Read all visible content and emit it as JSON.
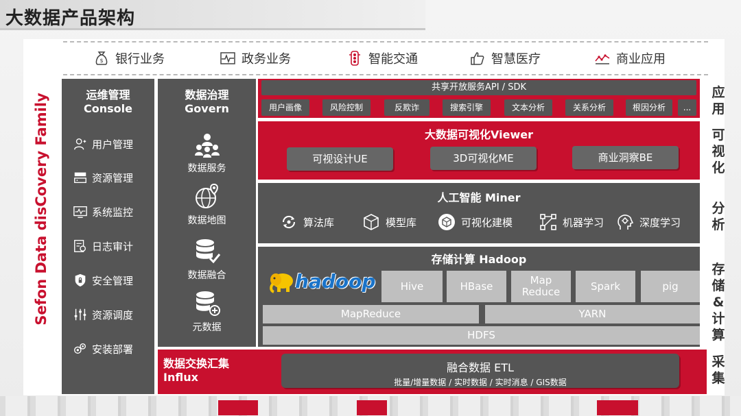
{
  "title": "大数据产品架构",
  "industries": [
    {
      "label": "银行业务",
      "icon": "bank-bag-icon"
    },
    {
      "label": "政务业务",
      "icon": "pulse-icon"
    },
    {
      "label": "智能交通",
      "icon": "traffic-light-icon"
    },
    {
      "label": "智慧医疗",
      "icon": "thumbs-up-icon"
    },
    {
      "label": "商业应用",
      "icon": "line-chart-icon"
    }
  ],
  "family_title": "Sefon Data disCovery Family",
  "ops": {
    "title_cn": "运维管理",
    "title_en": "Console",
    "items": [
      "用户管理",
      "资源管理",
      "系统监控",
      "日志审计",
      "安全管理",
      "资源调度",
      "安装部署"
    ]
  },
  "govern": {
    "title_cn": "数据治理",
    "title_en": "Govern",
    "items": [
      "数据服务",
      "数据地图",
      "数据融合",
      "元数据"
    ]
  },
  "app": {
    "api_label": "共享开放服务API / SDK",
    "chips": [
      "用户画像",
      "风险控制",
      "反欺诈",
      "搜索引擎",
      "文本分析",
      "关系分析",
      "根因分析",
      "..."
    ]
  },
  "viewer": {
    "title": "大数据可视化Viewer",
    "items": [
      "可视设计UE",
      "3D可视化ME",
      "商业洞察BE"
    ]
  },
  "miner": {
    "title": "人工智能 Miner",
    "items": [
      "算法库",
      "模型库",
      "可视化建模",
      "机器学习",
      "深度学习"
    ]
  },
  "hadoop": {
    "title": "存储计算 Hadoop",
    "logo_text": "hadoop",
    "components": [
      "Hive",
      "HBase",
      "Map\nReduce",
      "Spark",
      "pig"
    ],
    "mapreduce": "MapReduce",
    "yarn": "YARN",
    "hdfs": "HDFS"
  },
  "influx": {
    "title_cn": "数据交换汇集",
    "title_en": "Influx",
    "etl_title": "融合数据 ETL",
    "etl_sub": "批量/增量数据 / 实时数据 / 实时消息 / GIS数据"
  },
  "side_labels": {
    "app": "应用",
    "viz": "可视化",
    "analysis": "分析",
    "storage": "存储&计算",
    "collect": "采集"
  },
  "colors": {
    "red": "#c8102e",
    "dark": "#555555",
    "light_box": "#bfbfbf"
  }
}
